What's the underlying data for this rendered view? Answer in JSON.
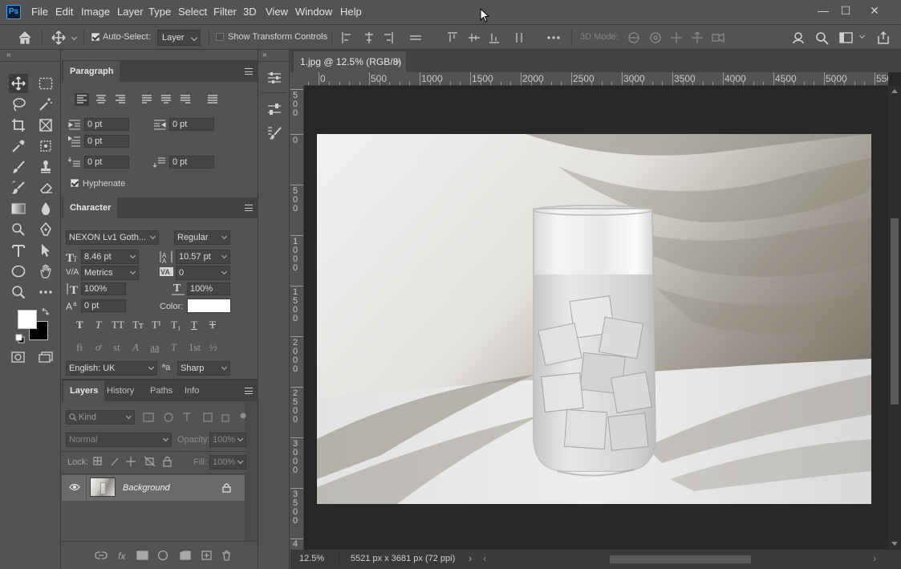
{
  "app": {
    "logo": "Ps",
    "menus": [
      "File",
      "Edit",
      "Image",
      "Layer",
      "Type",
      "Select",
      "Filter",
      "3D",
      "View",
      "Window",
      "Help"
    ],
    "window_controls": {
      "minimize": "—",
      "maximize": "☐",
      "close": "✕"
    }
  },
  "options_bar": {
    "auto_select_label": "Auto-Select:",
    "auto_select_checked": true,
    "auto_select_target": "Layer",
    "show_transform_label": "Show Transform Controls",
    "show_transform_checked": false,
    "mode_3d_label": "3D Mode:"
  },
  "paragraph_panel": {
    "tab": "Paragraph",
    "indent_left": "0 pt",
    "indent_right": "0 pt",
    "indent_first": "0 pt",
    "space_before": "0 pt",
    "space_after": "0 pt",
    "hyphenate_label": "Hyphenate",
    "hyphenate_checked": true
  },
  "character_panel": {
    "tab": "Character",
    "font_family": "NEXON Lv1 Goth...",
    "font_style": "Regular",
    "font_size": "8.46 pt",
    "leading": "10.57 pt",
    "kerning": "Metrics",
    "tracking": "0",
    "vertical_scale": "100%",
    "horizontal_scale": "100%",
    "baseline_shift": "0 pt",
    "color_label": "Color:",
    "text_color": "#ffffff",
    "style_buttons_1": [
      "T",
      "T",
      "TT",
      "Tт",
      "T¹",
      "T₁",
      "T",
      "T"
    ],
    "style_buttons_2": [
      "fi",
      "ơ",
      "st",
      "A",
      "aa",
      "T",
      "1st",
      "½"
    ],
    "language": "English: UK",
    "aa_icon": "ªa",
    "anti_alias": "Sharp"
  },
  "layers_panel": {
    "tabs": [
      "Layers",
      "History",
      "Paths",
      "Info"
    ],
    "filter_placeholder": "Kind",
    "blend_mode": "Normal",
    "opacity_label": "Opacity:",
    "opacity": "100%",
    "lock_label": "Lock:",
    "fill_label": "Fill:",
    "fill": "100%",
    "layers": [
      {
        "name": "Background",
        "visible": true,
        "locked": true
      }
    ]
  },
  "document": {
    "tab_title": "1.jpg @ 12.5% (RGB/8)",
    "close_glyph": "×",
    "ruler_h": [
      "0",
      "500",
      "1000",
      "1500",
      "2000",
      "2500",
      "3000",
      "3500",
      "4000",
      "4500",
      "5000",
      "550"
    ],
    "ruler_v": [
      "5\n0\n0",
      "0",
      "5\n0\n0",
      "1\n0\n0\n0",
      "1\n5\n0\n0",
      "2\n0\n0\n0",
      "2\n5\n0\n0",
      "3\n0\n0\n0",
      "3\n5\n0\n0",
      "4"
    ],
    "zoom": "12.5%",
    "doc_info": "5521 px x 3681 px (72 ppi)"
  },
  "colors": {
    "foreground": "#ffffff",
    "background": "#000000",
    "accent": "#31a8ff"
  }
}
